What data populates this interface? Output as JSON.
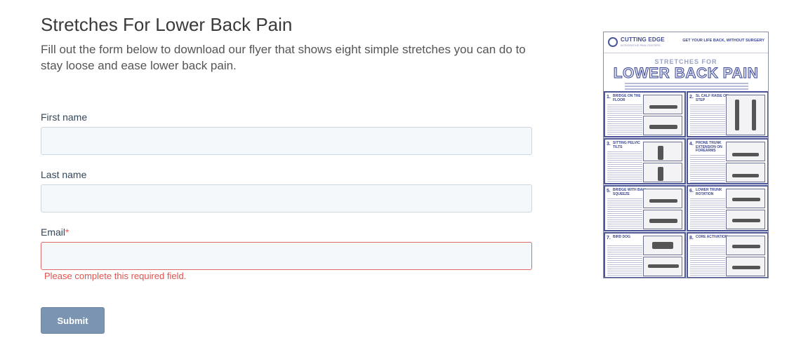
{
  "page": {
    "title": "Stretches For Lower Back Pain",
    "description": "Fill out the form below to download our flyer that shows eight simple stretches you can do to stay loose and ease lower back pain."
  },
  "form": {
    "first_name_label": "First name",
    "last_name_label": "Last name",
    "email_label": "Email",
    "required_marker": "*",
    "first_name_value": "",
    "last_name_value": "",
    "email_value": "",
    "email_error": "Please complete this required field.",
    "submit_label": "Submit"
  },
  "flyer": {
    "brand": "CUTTING EDGE",
    "brand_sub": "INTEGRATIVE PAIN CENTERS",
    "tagline": "GET YOUR LIFE BACK, WITHOUT SURGERY",
    "heading_small": "STRETCHES FOR",
    "heading_big": "LOWER BACK PAIN",
    "stretches": [
      {
        "num": "1.",
        "title": "BRIDGE ON THE FLOOR"
      },
      {
        "num": "2.",
        "title": "SL CALF RAISE ON STEP"
      },
      {
        "num": "3.",
        "title": "SITTING PELVIC TILTS"
      },
      {
        "num": "4.",
        "title": "PRONE TRUNK EXTENSION ON FOREARMS"
      },
      {
        "num": "5.",
        "title": "BRIDGE WITH BALL SQUEEZE"
      },
      {
        "num": "6.",
        "title": "LOWER TRUNK ROTATION"
      },
      {
        "num": "7.",
        "title": "BIRD DOG"
      },
      {
        "num": "8.",
        "title": "CORE ACTIVATION"
      }
    ]
  },
  "colors": {
    "accent": "#7b94b1",
    "error": "#e0534f",
    "flyer_navy": "#3c4790"
  }
}
